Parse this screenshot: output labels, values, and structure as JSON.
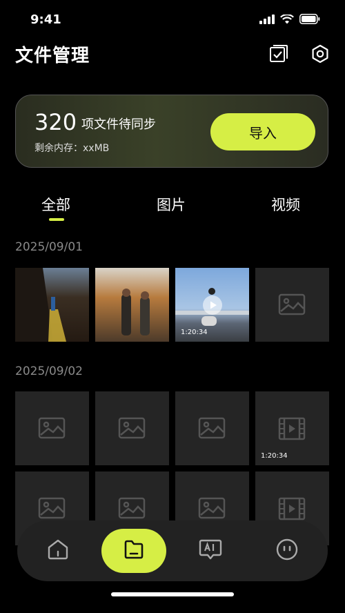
{
  "status": {
    "time": "9:41"
  },
  "header": {
    "title": "文件管理"
  },
  "sync_card": {
    "count": "320",
    "text": "项文件待同步",
    "storage": "剩余内存：xxMB",
    "import_label": "导入"
  },
  "tabs": [
    {
      "label": "全部",
      "active": true
    },
    {
      "label": "图片"
    },
    {
      "label": "视频"
    }
  ],
  "groups": [
    {
      "date": "2025/09/01"
    },
    {
      "date": "2025/09/02"
    }
  ],
  "durations": {
    "video_1": "1:20:34",
    "video_2": "1:20:34"
  },
  "colors": {
    "accent": "#d6ee45",
    "background": "#000000",
    "tile": "#252525",
    "nav": "#222222"
  },
  "nav": [
    "home-icon",
    "folder-icon",
    "ai-chat-icon",
    "profile-icon"
  ]
}
